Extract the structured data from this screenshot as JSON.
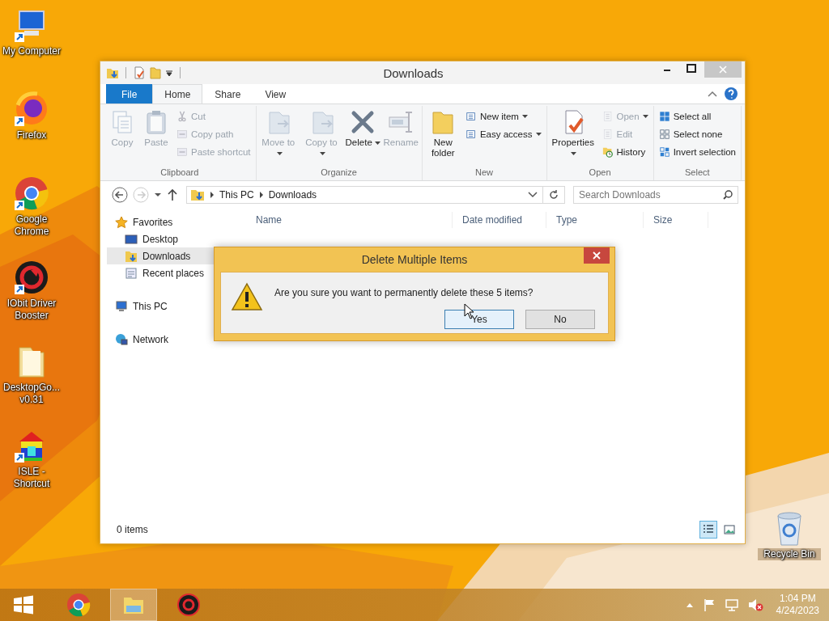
{
  "desktop_icons": [
    {
      "label": "My Computer"
    },
    {
      "label": "Firefox"
    },
    {
      "label": "Google Chrome"
    },
    {
      "label": "IObit Driver Booster"
    },
    {
      "label": "DesktopGo... v0.31"
    },
    {
      "label": "ISLE - Shortcut"
    },
    {
      "label": "Recycle Bin"
    }
  ],
  "window": {
    "title": "Downloads",
    "tabs": [
      {
        "label": "File",
        "kind": "file",
        "selected": false
      },
      {
        "label": "Home",
        "kind": "tab",
        "selected": true
      },
      {
        "label": "Share",
        "kind": "tab",
        "selected": false
      },
      {
        "label": "View",
        "kind": "tab",
        "selected": false
      }
    ],
    "ribbon": [
      {
        "label": "Clipboard",
        "items": [
          {
            "label": "Copy",
            "kind": "large",
            "disabled": true,
            "dropdown": false
          },
          {
            "label": "Paste",
            "kind": "large",
            "disabled": true,
            "dropdown": false
          },
          {
            "label": "Cut",
            "kind": "small",
            "disabled": true,
            "dropdown": false
          },
          {
            "label": "Copy path",
            "kind": "small",
            "disabled": true,
            "dropdown": false
          },
          {
            "label": "Paste shortcut",
            "kind": "small",
            "disabled": true,
            "dropdown": false
          }
        ]
      },
      {
        "label": "Organize",
        "items": [
          {
            "label": "Move to",
            "kind": "large",
            "disabled": true,
            "dropdown": true
          },
          {
            "label": "Copy to",
            "kind": "large",
            "disabled": true,
            "dropdown": true
          },
          {
            "label": "Delete",
            "kind": "large",
            "disabled": false,
            "dropdown": true
          },
          {
            "label": "Rename",
            "kind": "large",
            "disabled": true,
            "dropdown": false
          }
        ]
      },
      {
        "label": "New",
        "items": [
          {
            "label": "New folder",
            "kind": "large",
            "disabled": false,
            "dropdown": false
          },
          {
            "label": "New item",
            "kind": "small",
            "disabled": false,
            "dropdown": true
          },
          {
            "label": "Easy access",
            "kind": "small",
            "disabled": false,
            "dropdown": true
          }
        ]
      },
      {
        "label": "Open",
        "items": [
          {
            "label": "Properties",
            "kind": "large",
            "disabled": false,
            "dropdown": true
          },
          {
            "label": "Open",
            "kind": "small",
            "disabled": true,
            "dropdown": true
          },
          {
            "label": "Edit",
            "kind": "small",
            "disabled": true,
            "dropdown": false
          },
          {
            "label": "History",
            "kind": "small",
            "disabled": false,
            "dropdown": false
          }
        ]
      },
      {
        "label": "Select",
        "items": [
          {
            "label": "Select all",
            "kind": "small",
            "disabled": false,
            "dropdown": false
          },
          {
            "label": "Select none",
            "kind": "small",
            "disabled": false,
            "dropdown": false
          },
          {
            "label": "Invert selection",
            "kind": "small",
            "disabled": false,
            "dropdown": false
          }
        ]
      }
    ],
    "address": {
      "crumbs": [
        "This PC",
        "Downloads"
      ]
    },
    "search": {
      "placeholder": "Search Downloads"
    },
    "nav": [
      {
        "label": "Favorites",
        "selected": false,
        "children": [
          {
            "label": "Desktop",
            "selected": false
          },
          {
            "label": "Downloads",
            "selected": true
          },
          {
            "label": "Recent places",
            "selected": false
          }
        ]
      },
      {
        "label": "This PC",
        "selected": false
      },
      {
        "label": "Network",
        "selected": false
      }
    ],
    "columns": [
      "Name",
      "Date modified",
      "Type",
      "Size"
    ],
    "status_bar": {
      "text": "0 items",
      "views": [
        {
          "kind": "details",
          "selected": true
        },
        {
          "kind": "large_icons",
          "selected": false
        }
      ]
    }
  },
  "dialog": {
    "title": "Delete Multiple Items",
    "message": "Are you sure you want to permanently delete these 5 items?",
    "buttons": [
      {
        "label": "Yes",
        "selected": true
      },
      {
        "label": "No",
        "selected": false
      }
    ]
  },
  "taskbar": {
    "apps": [
      {
        "kind": "start",
        "selected": false
      },
      {
        "kind": "chrome",
        "selected": false
      },
      {
        "kind": "explorer",
        "selected": true
      },
      {
        "kind": "booster",
        "selected": false
      }
    ],
    "time": "1:04 PM",
    "date": "4/24/2023"
  }
}
